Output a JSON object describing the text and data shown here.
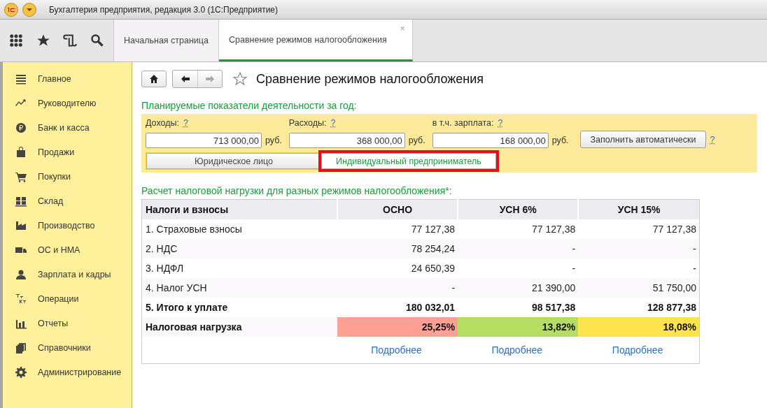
{
  "window": {
    "title": "Бухгалтерия предприятия, редакция 3.0  (1С:Предприятие)"
  },
  "tabs": [
    {
      "label": "Начальная страница",
      "selected": false
    },
    {
      "label": "Сравнение режимов налогообложения",
      "selected": true,
      "close": "×"
    }
  ],
  "sidebar": {
    "items": [
      {
        "label": "Главное"
      },
      {
        "label": "Руководителю"
      },
      {
        "label": "Банк и касса"
      },
      {
        "label": "Продажи"
      },
      {
        "label": "Покупки"
      },
      {
        "label": "Склад"
      },
      {
        "label": "Производство"
      },
      {
        "label": "ОС и НМА"
      },
      {
        "label": "Зарплата и кадры"
      },
      {
        "label": "Операции"
      },
      {
        "label": "Отчеты"
      },
      {
        "label": "Справочники"
      },
      {
        "label": "Администрирование"
      }
    ]
  },
  "page": {
    "title": "Сравнение режимов налогообложения",
    "favorite": false
  },
  "plan": {
    "heading": "Планируемые показатели деятельности за год:",
    "fields": [
      {
        "label": "Доходы:",
        "help": "?",
        "value": "713 000,00",
        "unit": "руб."
      },
      {
        "label": "Расходы:",
        "help": "?",
        "value": "368 000,00",
        "unit": "руб."
      },
      {
        "label": "в т.ч. зарплата:",
        "help": "?",
        "value": "168 000,00",
        "unit": "руб."
      }
    ],
    "autofill_button": "Заполнить автоматически",
    "autofill_help": "?",
    "entity_options": [
      {
        "label": "Юридическое лицо",
        "selected": false,
        "highlighted": false
      },
      {
        "label": "Индивидуальный предприниматель",
        "selected": true,
        "highlighted": true
      }
    ]
  },
  "calc": {
    "heading": "Расчет налоговой нагрузки для разных режимов налогообложения*:",
    "columns": [
      "Налоги и взносы",
      "ОСНО",
      "УСН 6%",
      "УСН 15%"
    ],
    "rows": [
      {
        "kind": "normal",
        "cells": [
          "1. Страховые взносы",
          "77 127,38",
          "77 127,38",
          "77 127,38"
        ]
      },
      {
        "kind": "normal",
        "cells": [
          "2. НДС",
          "78 254,24",
          "-",
          "-"
        ]
      },
      {
        "kind": "normal",
        "cells": [
          "3. НДФЛ",
          "24 650,39",
          "-",
          "-"
        ]
      },
      {
        "kind": "normal",
        "cells": [
          "4. Налог УСН",
          "-",
          "21 390,00",
          "51 750,00"
        ]
      },
      {
        "kind": "total",
        "cells": [
          "5. Итого к уплате",
          "180 032,01",
          "98 517,38",
          "128 877,38"
        ]
      },
      {
        "kind": "load",
        "cells": [
          "Налоговая нагрузка"
        ],
        "values": [
          {
            "text": "25,25%",
            "color": "#ffa095"
          },
          {
            "text": "13,82%",
            "color": "#b5dd62"
          },
          {
            "text": "18,08%",
            "color": "#fde34c"
          }
        ]
      }
    ],
    "links": [
      "Подробнее",
      "Подробнее",
      "Подробнее"
    ]
  }
}
